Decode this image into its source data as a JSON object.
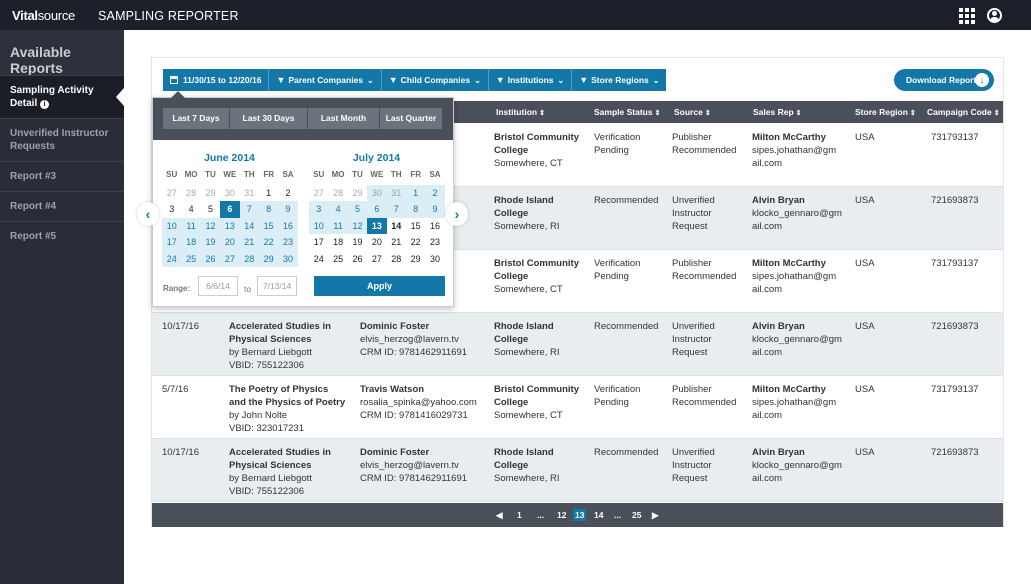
{
  "topbar": {
    "logo_bold": "Vital",
    "logo_light": "source",
    "title": "SAMPLING REPORTER"
  },
  "sidebar": {
    "header": "Available Reports",
    "items": [
      {
        "label": "Sampling Activity Detail"
      },
      {
        "label": "Unverified Instructor Requests"
      },
      {
        "label": "Report #3"
      },
      {
        "label": "Report #4"
      },
      {
        "label": "Report #5"
      }
    ]
  },
  "filters": {
    "date_range": "11/30/15 to 12/20/16",
    "parent": "Parent Companies",
    "child": "Child Companies",
    "institutions": "Institutions",
    "regions": "Store Regions",
    "download": "Download Report"
  },
  "table": {
    "headers": {
      "institution": "Institution",
      "status": "Sample Status",
      "source": "Source",
      "rep": "Sales Rep",
      "region": "Store Region",
      "campaign": "Campaign Code"
    },
    "rows": [
      {
        "date": "",
        "title": "",
        "author": "",
        "vbid": "",
        "customer": "",
        "email": ".com",
        "crm": "731",
        "inst1": "Bristol Community",
        "inst2": "College",
        "loc": "Somewhere, CT",
        "status1": "Verification",
        "status2": "Pending",
        "source1": "Publisher",
        "source2": "Recommended",
        "source3": "",
        "rep": "Milton McCarthy",
        "rep_email1": "sipes.johathan@gm",
        "rep_email2": "ail.com",
        "region": "USA",
        "campaign": "731793137"
      },
      {
        "date": "",
        "title": "",
        "author": "",
        "vbid": "",
        "customer": "",
        "email": "",
        "crm": "",
        "inst1": "Rhode Island",
        "inst2": "College",
        "loc": "Somewhere, RI",
        "status1": "Recommended",
        "status2": "",
        "source1": "Unverified",
        "source2": "Instructor",
        "source3": "Request",
        "rep": "Alvin Bryan",
        "rep_email1": "klocko_gennaro@gm",
        "rep_email2": "ail.com",
        "region": "USA",
        "campaign": "721693873"
      },
      {
        "date": "",
        "title": "",
        "author": "",
        "vbid": "",
        "customer": "",
        "email": ".com",
        "crm": "",
        "inst1": "Bristol Community",
        "inst2": "College",
        "loc": "Somewhere, CT",
        "status1": "Verification",
        "status2": "Pending",
        "source1": "Publisher",
        "source2": "Recommended",
        "source3": "",
        "rep": "Milton McCarthy",
        "rep_email1": "sipes.johathan@gm",
        "rep_email2": "ail.com",
        "region": "USA",
        "campaign": "731793137"
      },
      {
        "date": "10/17/16",
        "title": "Accelerated Studies in Physical Sciences",
        "author": "by Bernard Liebgott",
        "vbid": "VBID:  755122306",
        "customer": "Dominic Foster",
        "email": "elvis_herzog@lavern.tv",
        "crm": "CRM ID:  9781462911691",
        "inst1": "Rhode Island",
        "inst2": "College",
        "loc": "Somewhere, RI",
        "status1": "Recommended",
        "status2": "",
        "source1": "Unverified",
        "source2": "Instructor",
        "source3": "Request",
        "rep": "Alvin Bryan",
        "rep_email1": "klocko_gennaro@gm",
        "rep_email2": "ail.com",
        "region": "USA",
        "campaign": "721693873"
      },
      {
        "date": "5/7/16",
        "title": "The Poetry of Physics and the Physics of Poetry",
        "author": "by John Nolte",
        "vbid": "VBID:  323017231",
        "customer": "Travis Watson",
        "email": "rosalia_spinka@yahoo.com",
        "crm": "CRM ID:  9781416029731",
        "inst1": "Bristol Community",
        "inst2": "College",
        "loc": "Somewhere, CT",
        "status1": "Verification",
        "status2": "Pending",
        "source1": "Publisher",
        "source2": "Recommended",
        "source3": "",
        "rep": "Milton McCarthy",
        "rep_email1": "sipes.johathan@gm",
        "rep_email2": "ail.com",
        "region": "USA",
        "campaign": "731793137"
      },
      {
        "date": "10/17/16",
        "title": "Accelerated Studies in Physical Sciences",
        "author": "by Bernard Liebgott",
        "vbid": "VBID:  755122306",
        "customer": "Dominic Foster",
        "email": "elvis_herzog@lavern.tv",
        "crm": "CRM ID:  9781462911691",
        "inst1": "Rhode Island",
        "inst2": "College",
        "loc": "Somewhere, RI",
        "status1": "Recommended",
        "status2": "",
        "source1": "Unverified",
        "source2": "Instructor",
        "source3": "Request",
        "rep": "Alvin Bryan",
        "rep_email1": "klocko_gennaro@gm",
        "rep_email2": "ail.com",
        "region": "USA",
        "campaign": "721693873"
      }
    ]
  },
  "pagination": {
    "pages": [
      "1",
      "...",
      "12",
      "13",
      "14",
      "...",
      "25"
    ],
    "current": "13"
  },
  "picker": {
    "quick": [
      "Last 7 Days",
      "Last 30 Days",
      "Last Month",
      "Last Quarter"
    ],
    "dow": [
      "SU",
      "MO",
      "TU",
      "WE",
      "TH",
      "FR",
      "SA"
    ],
    "month1": {
      "name": "June 2014",
      "days": [
        {
          "t": "27",
          "k": "o"
        },
        {
          "t": "28",
          "k": "o"
        },
        {
          "t": "29",
          "k": "o"
        },
        {
          "t": "30",
          "k": "o"
        },
        {
          "t": "31",
          "k": "o"
        },
        {
          "t": "1",
          "k": ""
        },
        {
          "t": "2",
          "k": ""
        },
        {
          "t": "3",
          "k": ""
        },
        {
          "t": "4",
          "k": ""
        },
        {
          "t": "5",
          "k": ""
        },
        {
          "t": "6",
          "k": "s"
        },
        {
          "t": "7",
          "k": "r"
        },
        {
          "t": "8",
          "k": "r"
        },
        {
          "t": "9",
          "k": "r"
        },
        {
          "t": "10",
          "k": "r"
        },
        {
          "t": "11",
          "k": "r"
        },
        {
          "t": "12",
          "k": "r"
        },
        {
          "t": "13",
          "k": "r"
        },
        {
          "t": "14",
          "k": "r"
        },
        {
          "t": "15",
          "k": "r"
        },
        {
          "t": "16",
          "k": "r"
        },
        {
          "t": "17",
          "k": "r"
        },
        {
          "t": "18",
          "k": "r"
        },
        {
          "t": "19",
          "k": "r"
        },
        {
          "t": "20",
          "k": "r"
        },
        {
          "t": "21",
          "k": "r"
        },
        {
          "t": "22",
          "k": "r"
        },
        {
          "t": "23",
          "k": "r"
        },
        {
          "t": "24",
          "k": "r"
        },
        {
          "t": "25",
          "k": "r"
        },
        {
          "t": "26",
          "k": "r"
        },
        {
          "t": "27",
          "k": "r"
        },
        {
          "t": "28",
          "k": "r"
        },
        {
          "t": "29",
          "k": "r"
        },
        {
          "t": "30",
          "k": "r"
        }
      ]
    },
    "month2": {
      "name": "July 2014",
      "days": [
        {
          "t": "27",
          "k": "o"
        },
        {
          "t": "28",
          "k": "o"
        },
        {
          "t": "29",
          "k": "o"
        },
        {
          "t": "30",
          "k": "ro"
        },
        {
          "t": "31",
          "k": "ro"
        },
        {
          "t": "1",
          "k": "r"
        },
        {
          "t": "2",
          "k": "r"
        },
        {
          "t": "3",
          "k": "r"
        },
        {
          "t": "4",
          "k": "r"
        },
        {
          "t": "5",
          "k": "r"
        },
        {
          "t": "6",
          "k": "r"
        },
        {
          "t": "7",
          "k": "r"
        },
        {
          "t": "8",
          "k": "r"
        },
        {
          "t": "9",
          "k": "r"
        },
        {
          "t": "10",
          "k": "r"
        },
        {
          "t": "11",
          "k": "r"
        },
        {
          "t": "12",
          "k": "r"
        },
        {
          "t": "13",
          "k": "s"
        },
        {
          "t": "14",
          "k": "w"
        },
        {
          "t": "15",
          "k": ""
        },
        {
          "t": "16",
          "k": ""
        },
        {
          "t": "17",
          "k": ""
        },
        {
          "t": "18",
          "k": ""
        },
        {
          "t": "19",
          "k": ""
        },
        {
          "t": "20",
          "k": ""
        },
        {
          "t": "21",
          "k": ""
        },
        {
          "t": "22",
          "k": ""
        },
        {
          "t": "23",
          "k": ""
        },
        {
          "t": "24",
          "k": ""
        },
        {
          "t": "25",
          "k": ""
        },
        {
          "t": "26",
          "k": ""
        },
        {
          "t": "27",
          "k": ""
        },
        {
          "t": "28",
          "k": ""
        },
        {
          "t": "29",
          "k": ""
        },
        {
          "t": "30",
          "k": ""
        }
      ]
    },
    "range_label": "Range:",
    "range_from": "6/6/14",
    "range_to_label": "to",
    "range_to": "7/13/14",
    "apply": "Apply"
  },
  "icons": {
    "prev": "chevron-left-icon",
    "next": "chevron-right-icon",
    "apps": "grid-icon",
    "user": "user-circle-icon"
  },
  "colors": {
    "accent": "#1378a8",
    "topbar": "#1d1f2b",
    "sidebar": "#2a2d38",
    "table_header": "#4a5059"
  }
}
